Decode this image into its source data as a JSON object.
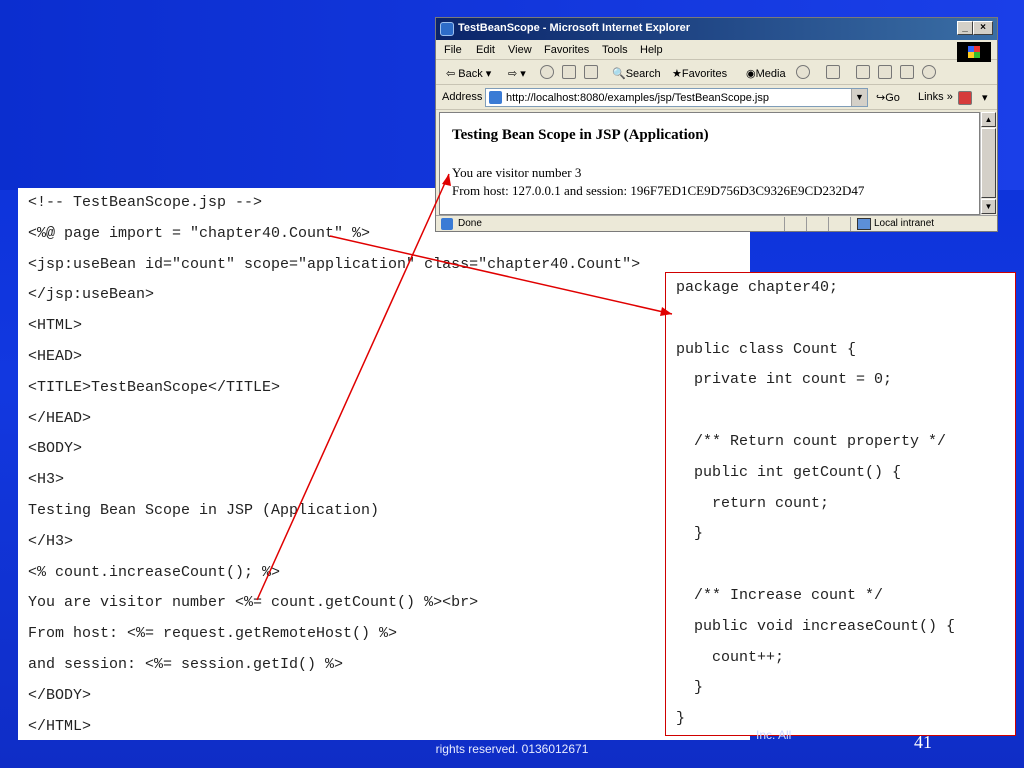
{
  "footer": {
    "left_text": "rights reserved. 0136012671",
    "right_text": "Inc. All",
    "page_number": "41"
  },
  "jsp_code": [
    "<!-- TestBeanScope.jsp -->",
    "<%@ page import = \"chapter40.Count\" %>",
    "<jsp:useBean id=\"count\" scope=\"application\" class=\"chapter40.Count\">",
    "</jsp:useBean>",
    "<HTML>",
    "<HEAD>",
    "<TITLE>TestBeanScope</TITLE>",
    "</HEAD>",
    "<BODY>",
    "<H3>",
    "Testing Bean Scope in JSP (Application)",
    "</H3>",
    "<% count.increaseCount(); %>",
    "You are visitor number <%= count.getCount() %><br>",
    "From host: <%= request.getRemoteHost() %>",
    "and session: <%= session.getId() %>",
    "</BODY>",
    "</HTML>"
  ],
  "java_code": [
    "package chapter40;",
    "",
    "public class Count {",
    "  private int count = 0;",
    "",
    "  /** Return count property */",
    "  public int getCount() {",
    "    return count;",
    "  }",
    "",
    "  /** Increase count */",
    "  public void increaseCount() {",
    "    count++;",
    "  }",
    "}"
  ],
  "browser": {
    "title": "TestBeanScope - Microsoft Internet Explorer",
    "menu": [
      "File",
      "Edit",
      "View",
      "Favorites",
      "Tools",
      "Help"
    ],
    "toolbar": {
      "back": "Back",
      "search": "Search",
      "favorites": "Favorites",
      "media": "Media"
    },
    "address_label": "Address",
    "address_url": "http://localhost:8080/examples/jsp/TestBeanScope.jsp",
    "go_label": "Go",
    "links_label": "Links",
    "page": {
      "heading": "Testing Bean Scope in JSP (Application)",
      "line1": "You are visitor number 3",
      "line2": "From host: 127.0.0.1 and session: 196F7ED1CE9D756D3C9326E9CD232D47"
    },
    "status": {
      "text": "Done",
      "zone": "Local intranet"
    }
  },
  "colors": {
    "background": "#1238e0",
    "arrow": "#e00000",
    "panel_border": "#d00000"
  }
}
